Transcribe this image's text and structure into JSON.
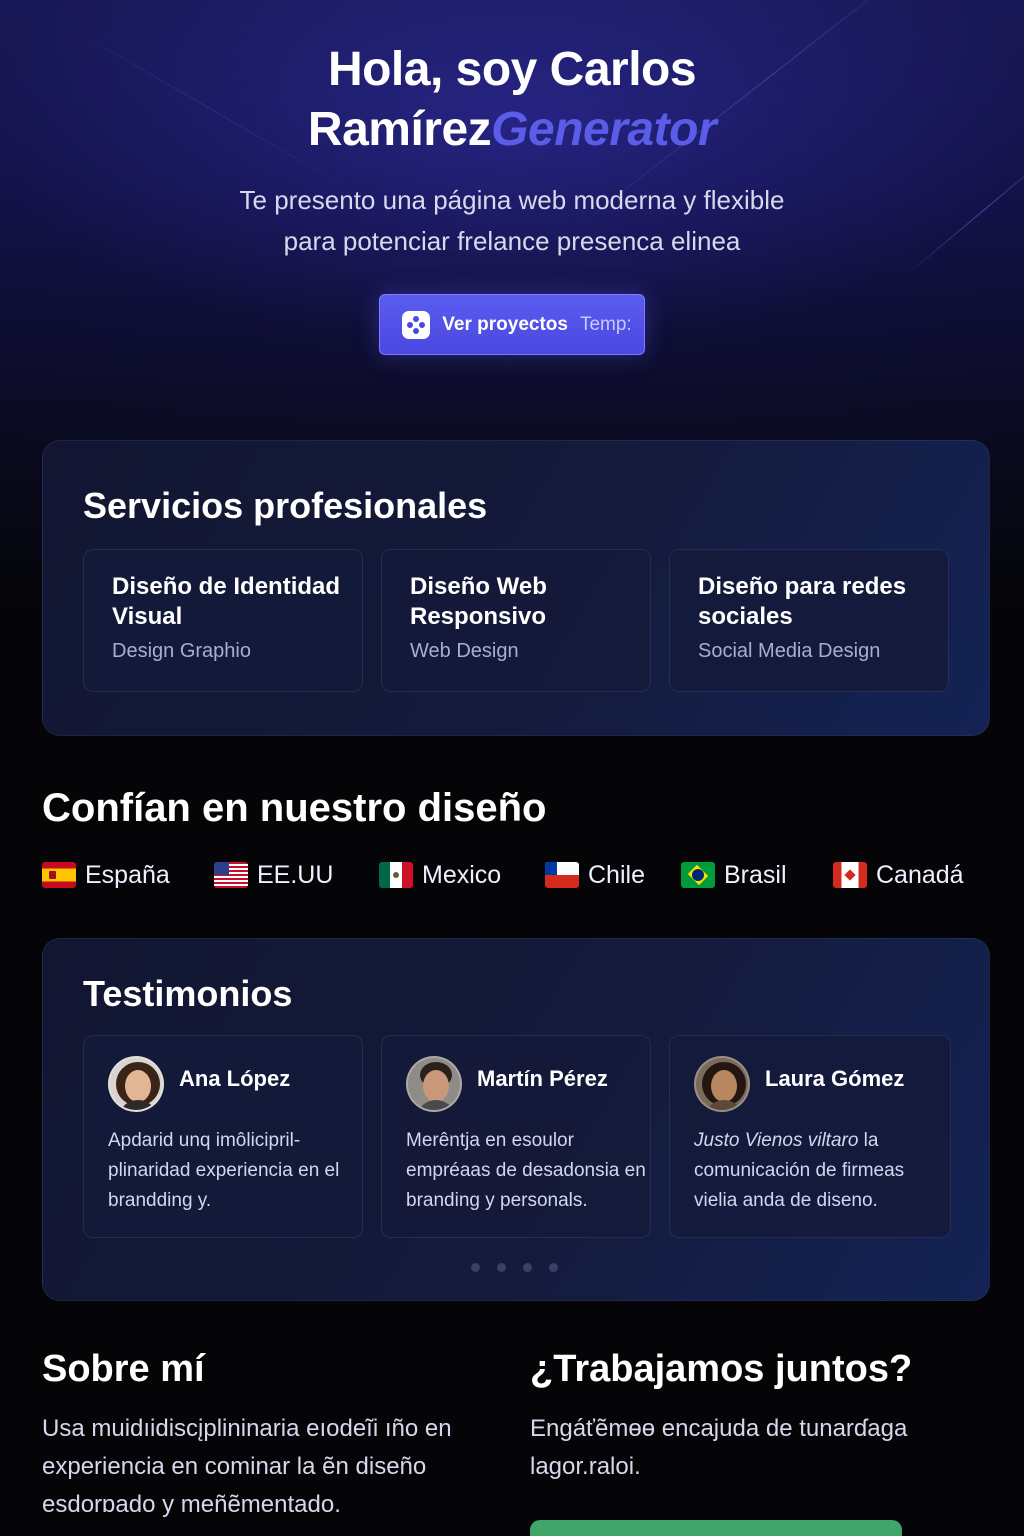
{
  "hero": {
    "title_main": "Hola, soy Carlos Ramírez",
    "title_accent": "Generator",
    "subtitle": "Te presento una página web moderna y flexible para potenciar frelance presenca elinea",
    "cta_label": "Ver proyectos",
    "cta_tail": "Temp:",
    "cta_icon": "gamepad-icon"
  },
  "services": {
    "title": "Servicios profesionales",
    "items": [
      {
        "title": "Diseño de Identidad Visual",
        "subtitle": "Design Graphio"
      },
      {
        "title": "Diseño Web Responsivo",
        "subtitle": "Web Design"
      },
      {
        "title": "Diseño para redes sociales",
        "subtitle": "Social Media Design"
      }
    ]
  },
  "trust": {
    "title": "Confían en nuestro diseño",
    "countries": [
      {
        "name": "España",
        "flag": "spain-flag-icon"
      },
      {
        "name": "EE.UU",
        "flag": "usa-flag-icon"
      },
      {
        "name": "Mexico",
        "flag": "mexico-flag-icon"
      },
      {
        "name": "Chile",
        "flag": "chile-flag-icon"
      },
      {
        "name": "Brasil",
        "flag": "brazil-flag-icon"
      },
      {
        "name": "Canadá",
        "flag": "canada-flag-icon"
      }
    ]
  },
  "testimonials": {
    "title": "Testimonios",
    "items": [
      {
        "name": "Ana López",
        "text": "Apdarid unq imôlicipril-plinaridad experiencia en el brandding y."
      },
      {
        "name": "Martín Pérez",
        "text": "Merêntja en esoulor empréaas de desadonsia en branding y personals."
      },
      {
        "name": "Laura Gómez",
        "text_italic": "Justo Vienos viltaro",
        "text": " la comunicación de firmeas vielia anda de diseno."
      }
    ],
    "pagination_dots": 4
  },
  "about": {
    "title": "Sobre mí",
    "text": "Usa muidıidiscįplininaria eıodeĩi ıño en experiencia en cominar la ẽn diseño esdorɒado y meñẽmentado."
  },
  "contact": {
    "title": "¿Trabajamos juntos?",
    "text": "Engáťẽmɵɵ encajuda de tunarɗaga lagor.raloi."
  },
  "colors": {
    "accent": "#5b5ce8",
    "cta_bg": "#4f4ee6",
    "panel_bg": "#131836",
    "contact_button": "#3fa56a"
  }
}
